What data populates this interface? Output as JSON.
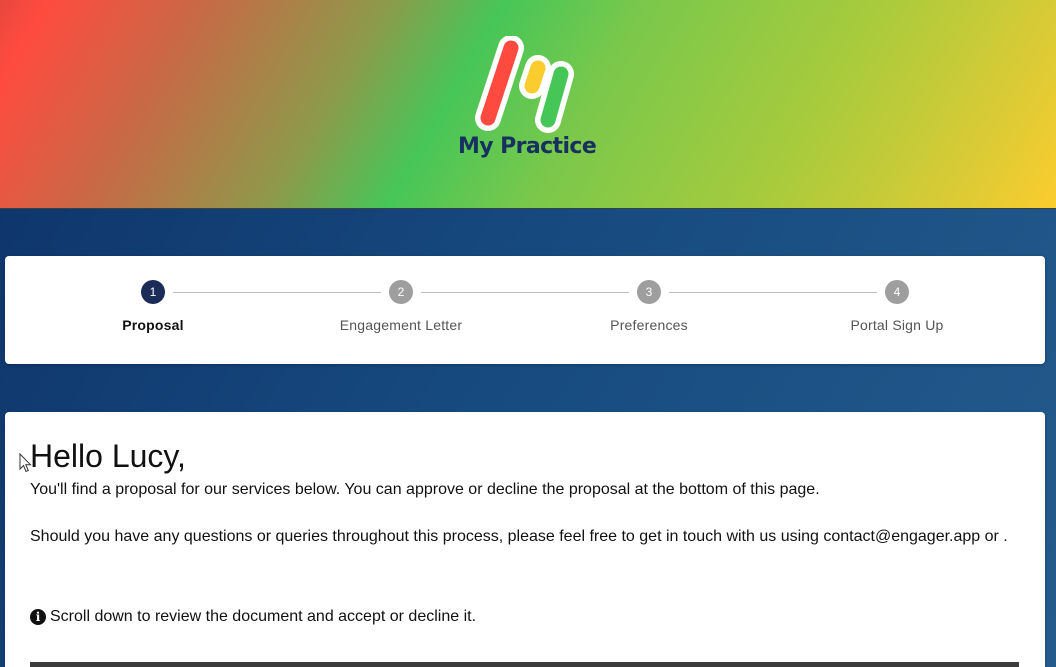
{
  "brand": {
    "name": "My Practice",
    "colors": {
      "red": "#ff4b3f",
      "yellow": "#fbcc2e",
      "green": "#47c658",
      "navy": "#17305f"
    }
  },
  "stepper": {
    "steps": [
      {
        "number": "1",
        "label": "Proposal",
        "active": true
      },
      {
        "number": "2",
        "label": "Engagement Letter",
        "active": false
      },
      {
        "number": "3",
        "label": "Preferences",
        "active": false
      },
      {
        "number": "4",
        "label": "Portal Sign Up",
        "active": false
      }
    ],
    "active_color": "#1a2c57",
    "inactive_color": "#9e9e9e"
  },
  "content": {
    "greeting": "Hello Lucy,",
    "intro": "You'll find a proposal for our services below. You can approve or decline the proposal at the bottom of this page.",
    "contact": "Should you have any questions or queries throughout this process, please feel free to get in touch with us using contact@engager.app or .",
    "info_icon": "info-circle-icon",
    "info_glyph": "i",
    "instruction": "Scroll down to review the document and accept or decline it."
  }
}
